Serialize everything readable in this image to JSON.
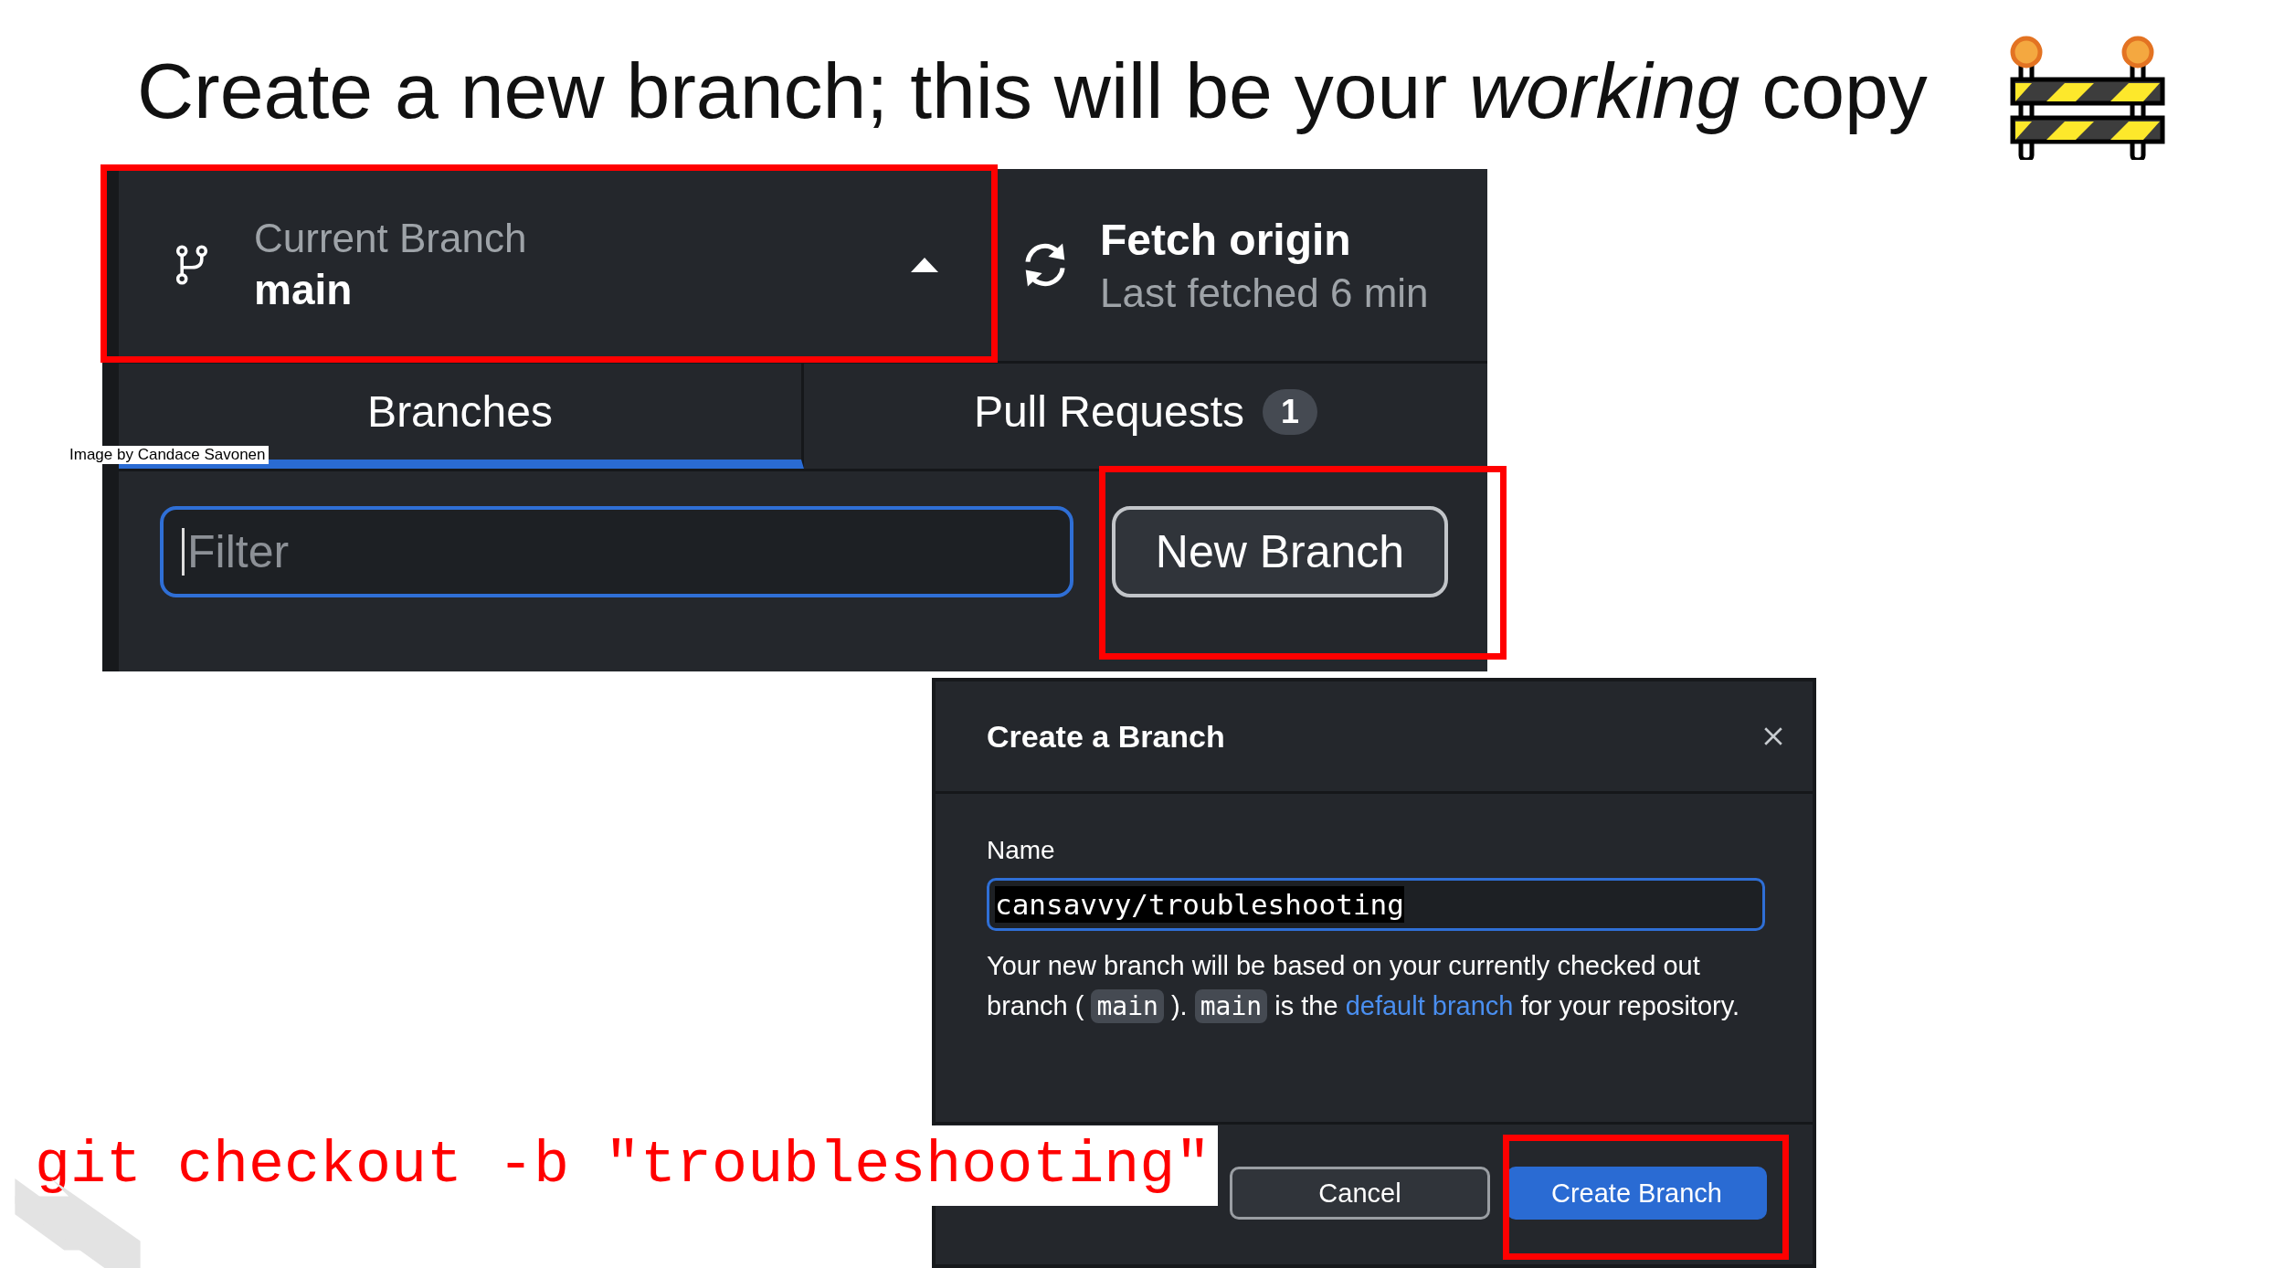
{
  "slide": {
    "title": "Create a new branch; this will be your *working* copy",
    "credit": "Image by Candace Savonen",
    "command": "git checkout -b \"troubleshooting\""
  },
  "toolbar": {
    "branch_label": "Current Branch",
    "branch_name": "main",
    "fetch_title": "Fetch origin",
    "fetch_subtitle": "Last fetched 6 min"
  },
  "tabs": [
    {
      "label": "Branches",
      "selected": true
    },
    {
      "label": "Pull Requests",
      "selected": false,
      "badge": "1"
    }
  ],
  "filter": {
    "placeholder": "Filter"
  },
  "new_branch_button": "New Branch",
  "dialog": {
    "title": "Create a Branch",
    "name_label": "Name",
    "name_value": "cansavvy/troubleshooting",
    "value_selected": true,
    "description": [
      {
        "kind": "text",
        "text": "Your new branch will be based on your currently checked out branch ("
      },
      {
        "kind": "code",
        "text": "main"
      },
      {
        "kind": "text",
        "text": ")."
      },
      {
        "kind": "code",
        "text": "main"
      },
      {
        "kind": "text",
        "text": "is the"
      },
      {
        "kind": "link",
        "text": "default branch"
      },
      {
        "kind": "text",
        "text": "for your repository."
      }
    ],
    "buttons": [
      {
        "label": "Cancel",
        "kind": "secondary"
      },
      {
        "label": "Create Branch",
        "kind": "primary"
      }
    ]
  }
}
